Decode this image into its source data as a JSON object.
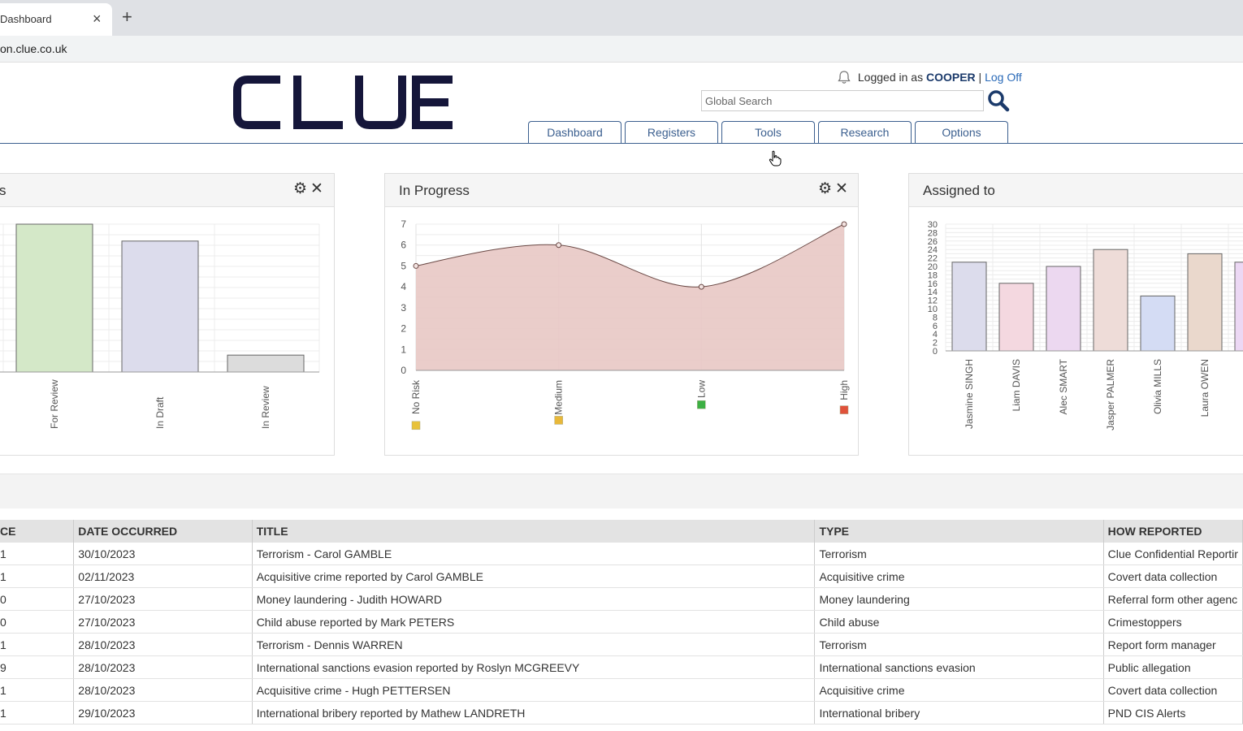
{
  "browser": {
    "tab_title": "Dashboard",
    "tab_close": "×",
    "new_tab": "+",
    "url": "on.clue.co.uk"
  },
  "header": {
    "logo_text": "CLUE",
    "logged_in_prefix": "Logged in as",
    "username": "COOPER",
    "separator": "|",
    "logoff": "Log Off",
    "search_placeholder": "Global Search"
  },
  "nav": {
    "tabs": [
      "Dashboard",
      "Registers",
      "Tools",
      "Research",
      "Options"
    ]
  },
  "widgets": {
    "left_title": "s",
    "in_progress_title": "In Progress",
    "assigned_title": "Assigned to",
    "gear": "⚙",
    "close": "✕"
  },
  "colors": {
    "brand_navy": "#15163a",
    "nav_blue": "#3b5f8f",
    "link_blue": "#2a6ab8"
  },
  "chart_data": [
    {
      "type": "bar",
      "categories": [
        "For Review",
        "In Draft",
        "In Review"
      ],
      "values": [
        7,
        6.2,
        0.8
      ],
      "ylim": [
        0,
        7
      ],
      "colors": [
        "#d4e8c8",
        "#dcdcec",
        "#dcdcdc"
      ],
      "grid": true
    },
    {
      "type": "area",
      "title": "In Progress",
      "categories": [
        "No Risk",
        "Medium",
        "Low",
        "High"
      ],
      "values": [
        5,
        6,
        4,
        7
      ],
      "ylim": [
        0,
        7
      ],
      "yticks": [
        0,
        1,
        2,
        3,
        4,
        5,
        6,
        7
      ],
      "marker_colors": [
        "#e8c23a",
        "#e8b83a",
        "#3cb043",
        "#e0523a"
      ],
      "fill": "#e8c8c4",
      "grid": true
    },
    {
      "type": "bar",
      "title": "Assigned to",
      "categories": [
        "Jasmine SINGH",
        "Liam DAVIS",
        "Alec SMART",
        "Jasper PALMER",
        "Olivia MILLS",
        "Laura OWEN",
        ""
      ],
      "values": [
        21,
        16,
        20,
        24,
        13,
        23,
        21
      ],
      "ylim": [
        0,
        30
      ],
      "yticks": [
        0,
        2,
        4,
        6,
        8,
        10,
        12,
        14,
        16,
        18,
        20,
        22,
        24,
        26,
        28,
        30
      ],
      "colors": [
        "#dcdcec",
        "#f4d8e0",
        "#ecd8f0",
        "#eedcd8",
        "#d4dcf4",
        "#ead8cc",
        "#ecd8f4"
      ],
      "grid": true
    }
  ],
  "table": {
    "columns": [
      "CE",
      "DATE OCCURRED",
      "TITLE",
      "TYPE",
      "HOW REPORTED"
    ],
    "rows": [
      [
        "1",
        "30/10/2023",
        "Terrorism - Carol GAMBLE",
        "Terrorism",
        "Clue Confidential Reportir"
      ],
      [
        "1",
        "02/11/2023",
        "Acquisitive crime reported by Carol GAMBLE",
        "Acquisitive crime",
        "Covert data collection"
      ],
      [
        "0",
        "27/10/2023",
        "Money laundering - Judith HOWARD",
        "Money laundering",
        "Referral form other agenc"
      ],
      [
        "0",
        "27/10/2023",
        "Child abuse reported by Mark PETERS",
        "Child abuse",
        "Crimestoppers"
      ],
      [
        "1",
        "28/10/2023",
        "Terrorism - Dennis WARREN",
        "Terrorism",
        "Report form manager"
      ],
      [
        "9",
        "28/10/2023",
        "International sanctions evasion reported by Roslyn MCGREEVY",
        "International sanctions evasion",
        "Public allegation"
      ],
      [
        "1",
        "28/10/2023",
        "Acquisitive crime - Hugh PETTERSEN",
        "Acquisitive crime",
        "Covert data collection"
      ],
      [
        "1",
        "29/10/2023",
        "International bribery reported by Mathew LANDRETH",
        "International bribery",
        "PND CIS Alerts"
      ]
    ]
  }
}
